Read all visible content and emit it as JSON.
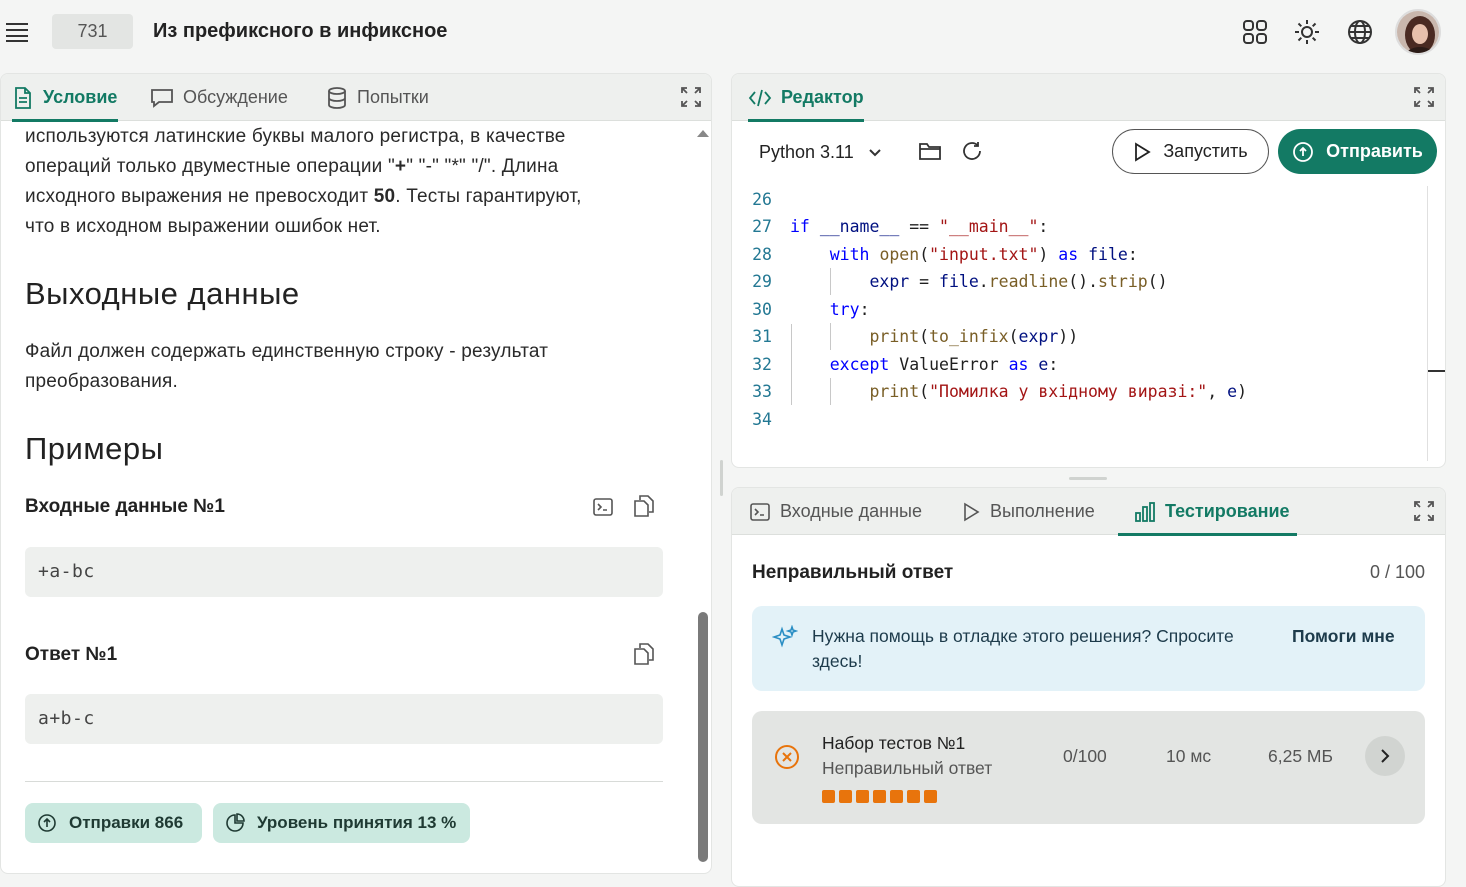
{
  "header": {
    "problem_number": "731",
    "problem_title": "Из префиксного в инфиксное"
  },
  "left_panel": {
    "tabs": [
      {
        "label": "Условие",
        "active": true
      },
      {
        "label": "Обсуждение",
        "active": false
      },
      {
        "label": "Попытки",
        "active": false
      }
    ],
    "statement": {
      "line1": "используются латинские буквы малого регистра, в качестве",
      "line2a": "операций только двуместные операции \"",
      "op_plus": "+",
      "line2b": "\" \"-\" \"*\" \"/\". Длина",
      "line3a": "исходного выражения не превосходит ",
      "max_len": "50",
      "line3b": ". Тесты гарантируют,",
      "line4": "что в исходном выражении ошибок нет."
    },
    "output_heading": "Выходные данные",
    "output_text_1": "Файл должен содержать единственную строку - результат",
    "output_text_2": "преобразования.",
    "examples_heading": "Примеры",
    "input_label": "Входные данные №1",
    "input_value": "+a-bc",
    "answer_label": "Ответ №1",
    "answer_value": "a+b-c",
    "submissions_chip": "Отправки 866",
    "acceptance_chip": "Уровень принятия 13 %"
  },
  "editor": {
    "tab_label": "Редактор",
    "language": "Python 3.11",
    "run_label": "Запустить",
    "submit_label": "Отправить",
    "lines": [
      {
        "n": "26",
        "text": ""
      },
      {
        "n": "27",
        "text": "if __name__ == \"__main__\":"
      },
      {
        "n": "28",
        "text": "    with open(\"input.txt\") as file:"
      },
      {
        "n": "29",
        "text": "        expr = file.readline().strip()"
      },
      {
        "n": "30",
        "text": "    try:"
      },
      {
        "n": "31",
        "text": "        print(to_infix(expr))"
      },
      {
        "n": "32",
        "text": "    except ValueError as e:"
      },
      {
        "n": "33",
        "text": "        print(\"Помилка у вхідному виразі:\", e)"
      },
      {
        "n": "34",
        "text": ""
      }
    ]
  },
  "bottom_panel": {
    "tabs": [
      {
        "label": "Входные данные",
        "active": false
      },
      {
        "label": "Выполнение",
        "active": false
      },
      {
        "label": "Тестирование",
        "active": true
      }
    ],
    "result_title": "Неправильный ответ",
    "score": "0 / 100",
    "help_text": "Нужна помощь в отладке этого решения? Спросите здесь!",
    "help_button": "Помоги мне",
    "test_set": {
      "title": "Набор тестов №1",
      "status": "Неправильный ответ",
      "score": "0/100",
      "time": "10 мс",
      "memory": "6,25 МБ",
      "failed_tests": 7
    }
  },
  "colors": {
    "accent": "#137a64",
    "error": "#e8740c",
    "help_bg": "#e3f2f8"
  }
}
